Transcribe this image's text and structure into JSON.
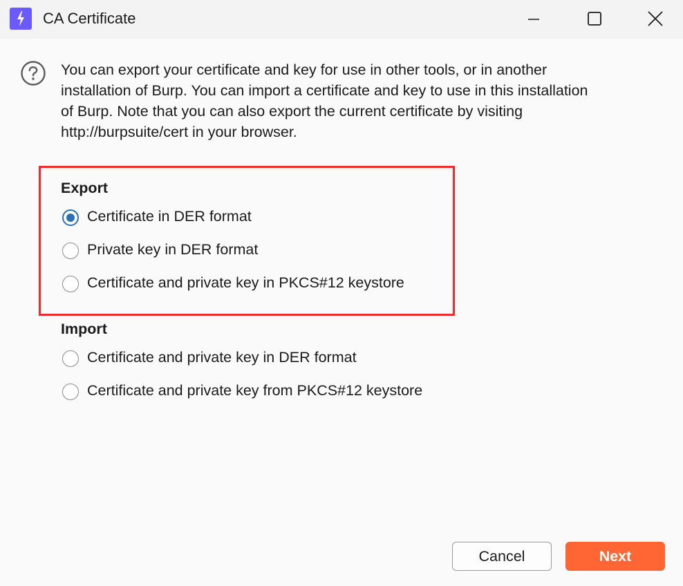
{
  "window": {
    "title": "CA Certificate",
    "app_icon": "burp-lightning-icon",
    "controls": [
      "minimize-icon",
      "maximize-icon",
      "close-icon"
    ]
  },
  "info": {
    "icon": "question-circle-icon",
    "lines": [
      "You can export your certificate and key for use in other tools, or in another",
      "installation of Burp. You can import a certificate and key to use in this installation",
      "of Burp. Note that you can also export the current certificate by visiting",
      "http://burpsuite/cert in your browser."
    ]
  },
  "export": {
    "heading": "Export",
    "options": [
      {
        "label": "Certificate in DER format",
        "selected": true
      },
      {
        "label": "Private key in DER format",
        "selected": false
      },
      {
        "label": "Certificate and private key in PKCS#12 keystore",
        "selected": false
      }
    ]
  },
  "import": {
    "heading": "Import",
    "options": [
      {
        "label": "Certificate and private key in DER format",
        "selected": false
      },
      {
        "label": "Certificate and private key from PKCS#12 keystore",
        "selected": false
      }
    ]
  },
  "footer": {
    "cancel_label": "Cancel",
    "next_label": "Next"
  },
  "colors": {
    "accent": "#ff6633",
    "radio_selected": "#2d6fb6",
    "highlight_border": "#ef2b2b",
    "app_icon_bg": "#6b5bff"
  }
}
